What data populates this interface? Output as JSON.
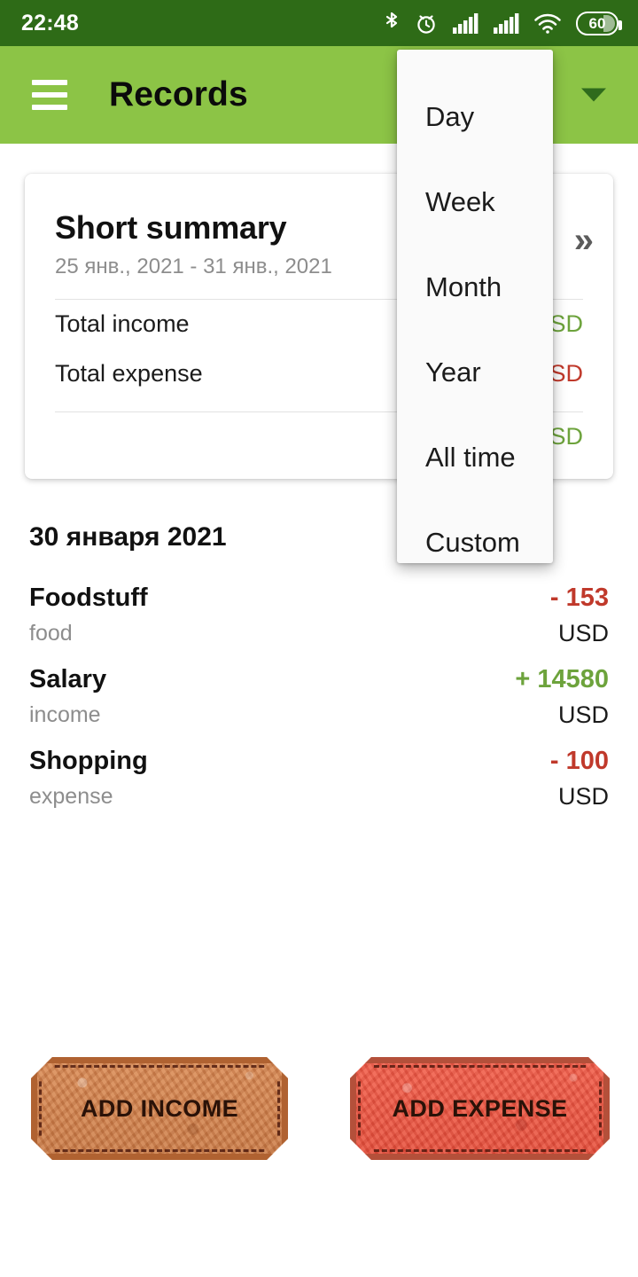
{
  "status_bar": {
    "time": "22:48",
    "battery_level": "60",
    "icons": [
      "bluetooth-icon",
      "alarm-icon",
      "signal-icon-1",
      "signal-icon-2",
      "wifi-icon",
      "battery-icon"
    ],
    "background_color": "#2E6B17"
  },
  "app_bar": {
    "title": "Records",
    "menu_icon": "hamburger-icon",
    "dropdown_icon": "chevron-down-icon",
    "background_color": "#8CC446"
  },
  "summary_card": {
    "title": "Short summary",
    "date_range": "25 янв., 2021 - 31 янв., 2021",
    "expand_icon": "double-chevron-right-icon",
    "rows": [
      {
        "label": "Total income",
        "value": "SD",
        "kind": "pos"
      },
      {
        "label": "Total expense",
        "value": "SD",
        "kind": "neg"
      }
    ],
    "total_row": {
      "label": "",
      "value": "SD",
      "kind": "pos"
    }
  },
  "records_section": {
    "date_header": "30 января 2021",
    "items": [
      {
        "title": "Foodstuff",
        "category": "food",
        "amount": "- 153",
        "currency": "USD",
        "kind": "neg"
      },
      {
        "title": "Salary",
        "category": "income",
        "amount": "+ 14580",
        "currency": "USD",
        "kind": "pos"
      },
      {
        "title": "Shopping",
        "category": "expense",
        "amount": "- 100",
        "currency": "USD",
        "kind": "neg"
      }
    ]
  },
  "actions": {
    "add_income_label": "ADD INCOME",
    "add_expense_label": "ADD EXPENSE",
    "income_color": "#C97A46",
    "expense_color": "#E54F3C"
  },
  "period_menu": {
    "open": true,
    "items": [
      {
        "label": "Day"
      },
      {
        "label": "Week"
      },
      {
        "label": "Month"
      },
      {
        "label": "Year"
      },
      {
        "label": "All time"
      },
      {
        "label": "Custom"
      }
    ]
  },
  "colors": {
    "positive": "#6DA33C",
    "negative": "#C0392B",
    "accent": "#8CC446",
    "status_bar": "#2E6B17"
  }
}
